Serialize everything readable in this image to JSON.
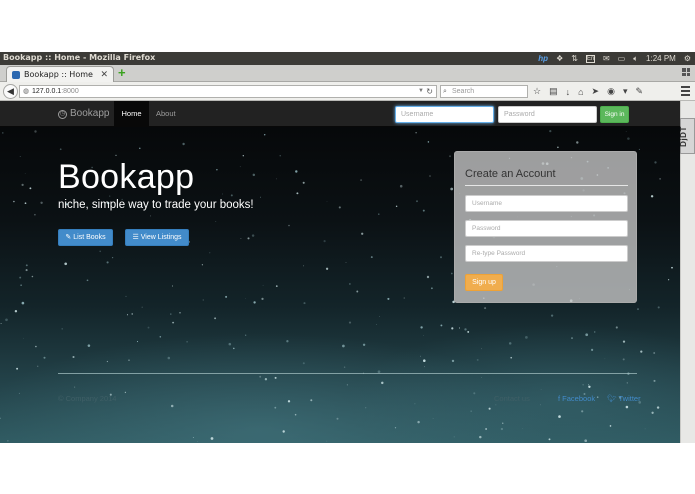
{
  "os": {
    "window_title": "Bookapp :: Home - Mozilla Firefox",
    "keyboard_layout": "En",
    "clock": "1:24 PM"
  },
  "browser": {
    "tab_title": "Bookapp :: Home",
    "url_host": "127.0.0.1",
    "url_port": ":8000",
    "search_placeholder": "Search",
    "addon_label": "DjDT"
  },
  "site": {
    "brand": "Bookapp",
    "nav": {
      "home": "Home",
      "about": "About"
    },
    "login": {
      "username_placeholder": "Username",
      "password_placeholder": "Password",
      "signin_label": "Sign in"
    },
    "hero": {
      "title": "Bookapp",
      "subtitle": "niche, simple way to trade your books!",
      "list_books_label": "List Books",
      "view_listings_label": "View Listings"
    },
    "signup": {
      "title": "Create an Account",
      "username_placeholder": "Username",
      "password_placeholder": "Password",
      "retype_placeholder": "Re-type Password",
      "signup_label": "Sign up"
    },
    "footer": {
      "copyright": "© Company 2014",
      "contact": "Contact us",
      "facebook": "Facebook",
      "twitter": "Twitter"
    }
  }
}
